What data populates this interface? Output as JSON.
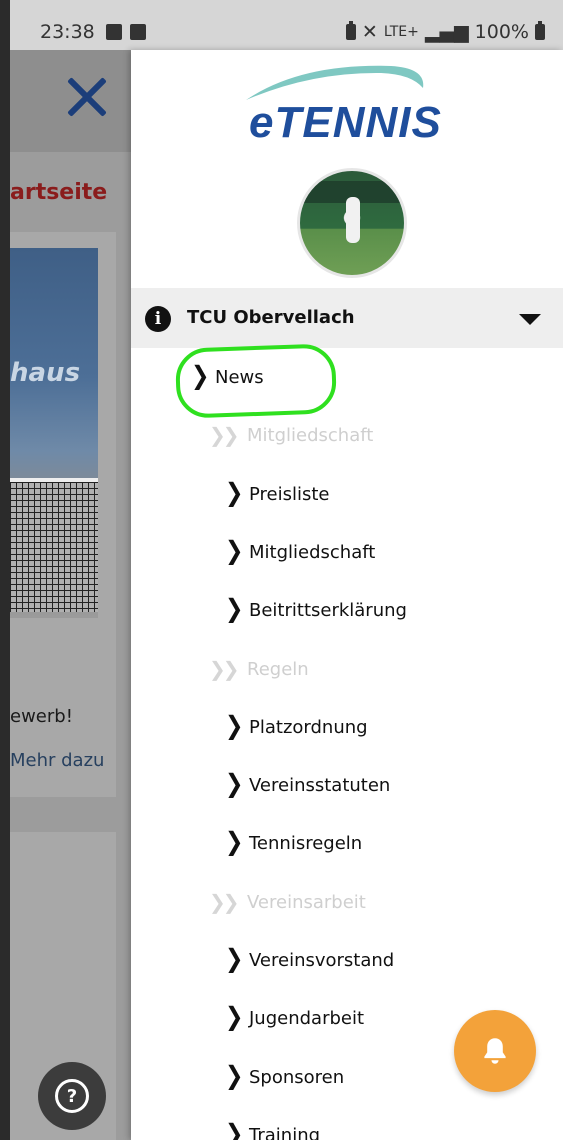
{
  "status_bar": {
    "time": "23:38",
    "network": "LTE+",
    "battery": "100%"
  },
  "background_page": {
    "start_label": "artseite",
    "photo_text": "haus",
    "card_text": "ewerb!",
    "more_link": "Mehr dazu"
  },
  "drawer": {
    "logo_text": "eTENNIS",
    "club_name": "TCU Obervellach",
    "items": [
      {
        "type": "link",
        "label": "News"
      },
      {
        "type": "section",
        "label": "Mitgliedschaft"
      },
      {
        "type": "link",
        "label": "Preisliste"
      },
      {
        "type": "link",
        "label": "Mitgliedschaft"
      },
      {
        "type": "link",
        "label": "Beitrittserklärung"
      },
      {
        "type": "section",
        "label": "Regeln"
      },
      {
        "type": "link",
        "label": "Platzordnung"
      },
      {
        "type": "link",
        "label": "Vereinsstatuten"
      },
      {
        "type": "link",
        "label": "Tennisregeln"
      },
      {
        "type": "section",
        "label": "Vereinsarbeit"
      },
      {
        "type": "link",
        "label": "Vereinsvorstand"
      },
      {
        "type": "link",
        "label": "Jugendarbeit"
      },
      {
        "type": "link",
        "label": "Sponsoren"
      },
      {
        "type": "link",
        "label": "Training"
      }
    ]
  },
  "colors": {
    "brand_blue": "#1f4e9c",
    "accent_orange": "#f3a23a",
    "highlight_green": "#2fe01f"
  },
  "icons": {
    "close": "close-icon",
    "info": "info-icon",
    "dropdown": "caret-down-icon",
    "help": "help-icon",
    "bell": "bell-icon"
  }
}
